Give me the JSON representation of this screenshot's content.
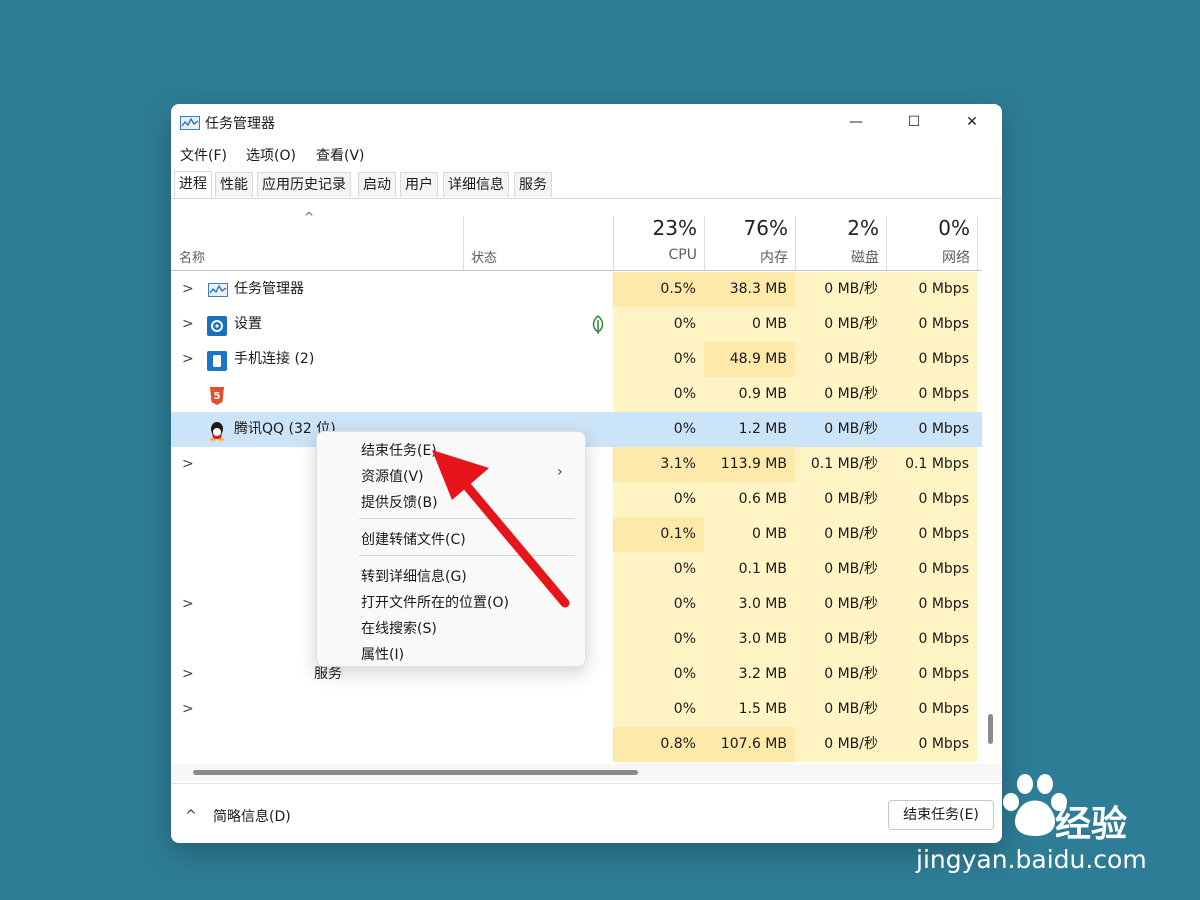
{
  "window": {
    "title": "任务管理器",
    "controls": {
      "minimize": "—",
      "maximize": "☐",
      "close": "✕"
    }
  },
  "menu": [
    "文件(F)",
    "选项(O)",
    "查看(V)"
  ],
  "tabs": [
    "进程",
    "性能",
    "应用历史记录",
    "启动",
    "用户",
    "详细信息",
    "服务"
  ],
  "header": {
    "sort_caret": "^",
    "name": "名称",
    "status": "状态",
    "cpu": {
      "pct": "23%",
      "label": "CPU"
    },
    "mem": {
      "pct": "76%",
      "label": "内存"
    },
    "disk": {
      "pct": "2%",
      "label": "磁盘"
    },
    "net": {
      "pct": "0%",
      "label": "网络"
    }
  },
  "rows": [
    {
      "chev": ">",
      "icon": "task-manager-icon",
      "name": "任务管理器",
      "cpu": "0.5%",
      "mem": "38.3 MB",
      "disk": "0 MB/秒",
      "net": "0 Mbps",
      "leaf": false
    },
    {
      "chev": ">",
      "icon": "settings-icon",
      "name": "设置",
      "cpu": "0%",
      "mem": "0 MB",
      "disk": "0 MB/秒",
      "net": "0 Mbps",
      "leaf": true
    },
    {
      "chev": ">",
      "icon": "phone-link-icon",
      "name": "手机连接 (2)",
      "cpu": "0%",
      "mem": "48.9 MB",
      "disk": "0 MB/秒",
      "net": "0 Mbps",
      "leaf": false
    },
    {
      "chev": "",
      "icon": "html5-icon",
      "name": "",
      "cpu": "0%",
      "mem": "0.9 MB",
      "disk": "0 MB/秒",
      "net": "0 Mbps",
      "leaf": false
    },
    {
      "chev": "",
      "icon": "qq-icon",
      "name": "腾讯QQ (32 位)",
      "cpu": "0%",
      "mem": "1.2 MB",
      "disk": "0 MB/秒",
      "net": "0 Mbps",
      "leaf": false,
      "selected": true
    },
    {
      "chev": ">",
      "icon": "",
      "name": "",
      "cpu": "3.1%",
      "mem": "113.9 MB",
      "disk": "0.1 MB/秒",
      "net": "0.1 Mbps",
      "leaf": false
    },
    {
      "chev": "",
      "icon": "",
      "name": "",
      "cpu": "0%",
      "mem": "0.6 MB",
      "disk": "0 MB/秒",
      "net": "0 Mbps",
      "leaf": false
    },
    {
      "chev": "",
      "icon": "",
      "name": "",
      "cpu": "0.1%",
      "mem": "0 MB",
      "disk": "0 MB/秒",
      "net": "0 Mbps",
      "leaf": false
    },
    {
      "chev": "",
      "icon": "",
      "name": "",
      "cpu": "0%",
      "mem": "0.1 MB",
      "disk": "0 MB/秒",
      "net": "0 Mbps",
      "leaf": false
    },
    {
      "chev": ">",
      "icon": "",
      "name": "",
      "cpu": "0%",
      "mem": "3.0 MB",
      "disk": "0 MB/秒",
      "net": "0 Mbps",
      "leaf": false
    },
    {
      "chev": "",
      "icon": "",
      "name": "",
      "cpu": "0%",
      "mem": "3.0 MB",
      "disk": "0 MB/秒",
      "net": "0 Mbps",
      "leaf": false
    },
    {
      "chev": ">",
      "icon": "",
      "name": "服务",
      "cpu": "0%",
      "mem": "3.2 MB",
      "disk": "0 MB/秒",
      "net": "0 Mbps",
      "leaf": false
    },
    {
      "chev": ">",
      "icon": "",
      "name": "",
      "cpu": "0%",
      "mem": "1.5 MB",
      "disk": "0 MB/秒",
      "net": "0 Mbps",
      "leaf": false
    },
    {
      "chev": "",
      "icon": "",
      "name": "",
      "cpu": "0.8%",
      "mem": "107.6 MB",
      "disk": "0 MB/秒",
      "net": "0 Mbps",
      "leaf": false
    }
  ],
  "context_menu": {
    "end_task": "结束任务(E)",
    "resource_values": "资源值(V)",
    "submenu_arrow": "›",
    "feedback": "提供反馈(B)",
    "dump_file": "创建转储文件(C)",
    "goto_details": "转到详细信息(G)",
    "open_location": "打开文件所在的位置(O)",
    "search_online": "在线搜索(S)",
    "properties": "属性(I)"
  },
  "footer": {
    "chevron": "^",
    "fewer_details": "简略信息(D)",
    "end_task_button": "结束任务(E)"
  },
  "watermark": {
    "logo_text": "经验",
    "url": "jingyan.baidu.com"
  },
  "colors": {
    "desktop": "#2e7d96",
    "heat_light": "#fff4c4",
    "heat_mid": "#fde9a9",
    "selection": "#cce4f7",
    "arrow": "#e8141b"
  }
}
